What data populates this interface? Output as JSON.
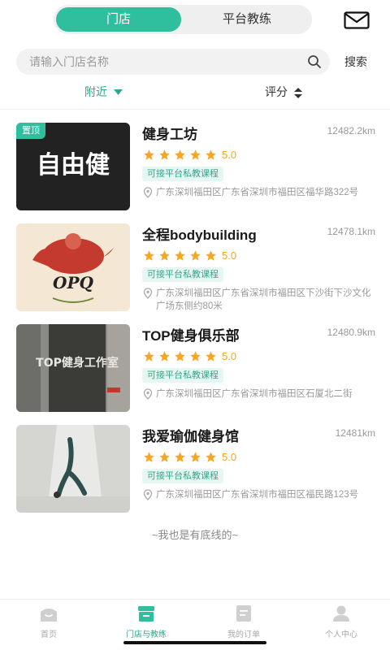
{
  "header": {
    "tabs": [
      {
        "label": "门店",
        "active": true
      },
      {
        "label": "平台教练",
        "active": false
      }
    ],
    "mail_icon": "envelope-icon"
  },
  "search": {
    "placeholder": "请输入门店名称",
    "button_label": "搜索",
    "icon": "search-icon"
  },
  "filters": {
    "nearby": "附近",
    "rating": "评分"
  },
  "colors": {
    "accent": "#2fbf9f",
    "accent_text": "#2fa88c",
    "star": "#f5a623",
    "tag_bg": "#e6f7f2"
  },
  "stores": [
    {
      "name": "健身工坊",
      "distance": "12482.2km",
      "rating": 5,
      "rating_text": "5.0",
      "tag": "可接平台私教课程",
      "address": "广东深圳福田区广东省深圳市福田区福华路322号",
      "badge": "置顶",
      "logo_text": "自由健"
    },
    {
      "name": "全程bodybuilding",
      "distance": "12478.1km",
      "rating": 5,
      "rating_text": "5.0",
      "tag": "可接平台私教课程",
      "address": "广东深圳福田区广东省深圳市福田区下沙街下沙文化广场东侧约80米",
      "logo_text": "OPQ"
    },
    {
      "name": "TOP健身俱乐部",
      "distance": "12480.9km",
      "rating": 5,
      "rating_text": "5.0",
      "tag": "可接平台私教课程",
      "address": "广东深圳福田区广东省深圳市福田区石厦北二街",
      "logo_text": "TOP健身工作室"
    },
    {
      "name": "我爱瑜伽健身馆",
      "distance": "12481km",
      "rating": 5,
      "rating_text": "5.0",
      "tag": "可接平台私教课程",
      "address": "广东深圳福田区广东省深圳市福田区福民路123号"
    }
  ],
  "footer_text": "~我也是有底线的~",
  "bottom_nav": [
    {
      "label": "首页",
      "icon": "home-icon",
      "active": false
    },
    {
      "label": "门店与教练",
      "icon": "store-icon",
      "active": true
    },
    {
      "label": "我的订单",
      "icon": "order-icon",
      "active": false
    },
    {
      "label": "个人中心",
      "icon": "profile-icon",
      "active": false
    }
  ]
}
